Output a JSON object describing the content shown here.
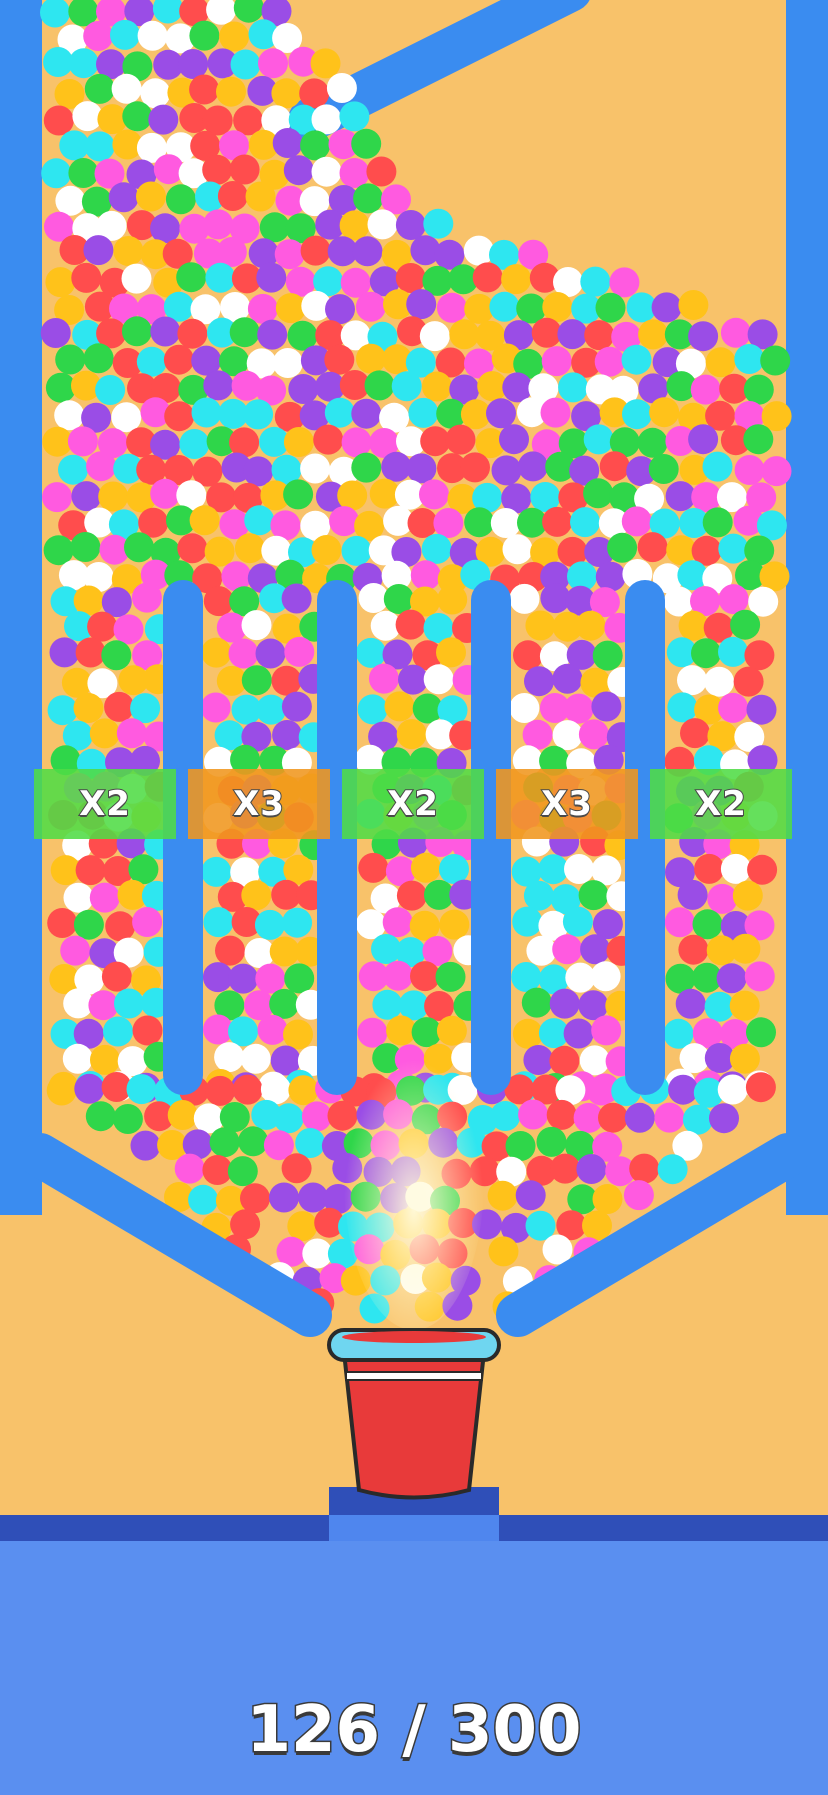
{
  "multipliers": [
    "X2",
    "X3",
    "X2",
    "X3",
    "X2"
  ],
  "progress_text": "126 / 300",
  "progress": {
    "current": 126,
    "total": 300
  },
  "colors": {
    "board": "#f8c26a",
    "walls": "#3a8cf0",
    "floor": "#5a8ff0",
    "floor_stripe": "#2f4fb8",
    "cup_red": "#e83a3a",
    "cup_rim": "#6fd6f0",
    "gate_x2": "#50dc46",
    "gate_x3": "#f0961e",
    "balls": [
      "#ff4d4d",
      "#ffc21a",
      "#2ee6f0",
      "#2fd64a",
      "#9a4de6",
      "#ff5ae0",
      "#ffffff"
    ]
  }
}
